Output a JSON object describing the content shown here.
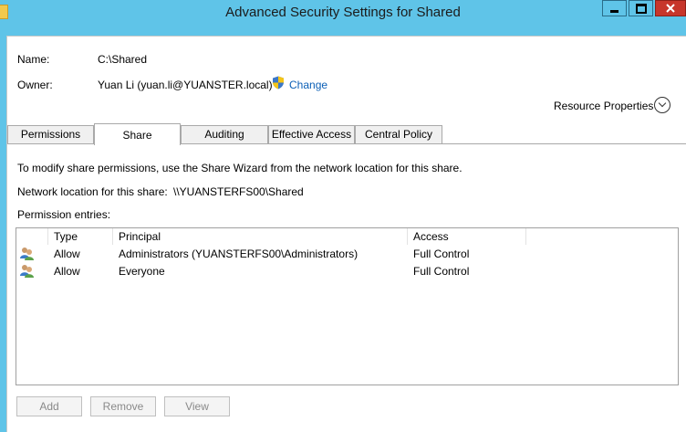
{
  "window": {
    "title": "Advanced Security Settings for Shared"
  },
  "header": {
    "name_label": "Name:",
    "name_value": "C:\\Shared",
    "owner_label": "Owner:",
    "owner_value": "Yuan Li (yuan.li@YUANSTER.local)",
    "change_link": "Change",
    "resource_properties": "Resource Properties"
  },
  "tabs": [
    {
      "label": "Permissions"
    },
    {
      "label": "Share"
    },
    {
      "label": "Auditing"
    },
    {
      "label": "Effective Access"
    },
    {
      "label": "Central Policy"
    }
  ],
  "share": {
    "info_text": "To modify share permissions, use the Share Wizard from the network location for this share.",
    "network_label": "Network location for this share:",
    "network_value": "\\\\YUANSTERFS00\\Shared",
    "entries_label": "Permission entries:"
  },
  "table": {
    "columns": [
      "Type",
      "Principal",
      "Access"
    ],
    "rows": [
      {
        "type": "Allow",
        "principal": "Administrators (YUANSTERFS00\\Administrators)",
        "access": "Full Control"
      },
      {
        "type": "Allow",
        "principal": "Everyone",
        "access": "Full Control"
      }
    ]
  },
  "buttons": {
    "add": "Add",
    "remove": "Remove",
    "view": "View"
  }
}
